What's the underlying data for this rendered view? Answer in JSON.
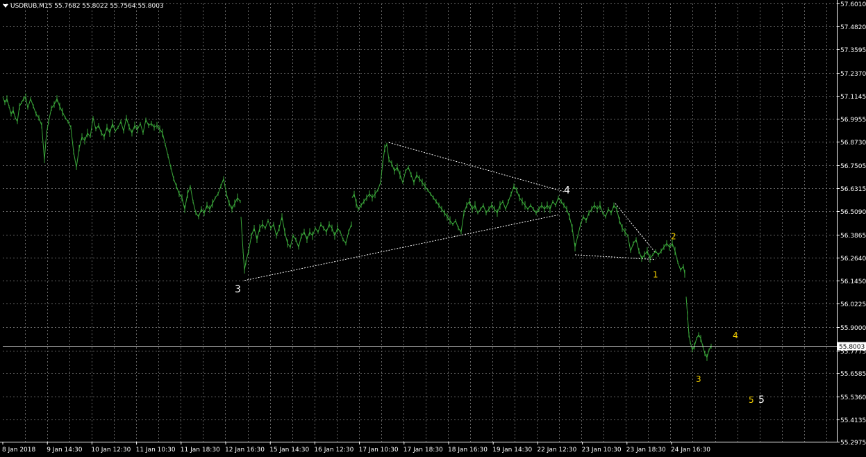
{
  "header": {
    "symbol": "USDRUB,M15",
    "open": "55.7682",
    "high": "55.8022",
    "low": "55.7564",
    "close": "55.8003"
  },
  "colors": {
    "background": "#000000",
    "grid": "#8a8a8a",
    "price_line": "#3aa83a",
    "axis_text": "#ffffff",
    "wave_white": "#ffffff",
    "wave_yellow": "#f5d000",
    "current_price_box": "#ffffff"
  },
  "chart_data": {
    "type": "line",
    "title": "USDRUB,M15",
    "grid": true,
    "ylim": [
      55.2975,
      57.601
    ],
    "y_ticks": [
      "57.6010",
      "57.4820",
      "57.3595",
      "57.2370",
      "57.1145",
      "56.9955",
      "56.8730",
      "56.7505",
      "56.6315",
      "56.5090",
      "56.3865",
      "56.2640",
      "56.1450",
      "56.0225",
      "55.9000",
      "55.7775",
      "55.6585",
      "55.5360",
      "55.4135",
      "55.2975"
    ],
    "x_tick_labels": [
      "8 Jan 2018",
      "9 Jan 14:30",
      "10 Jan 12:30",
      "11 Jan 10:30",
      "11 Jan 18:30",
      "12 Jan 16:30",
      "15 Jan 14:30",
      "16 Jan 12:30",
      "17 Jan 10:30",
      "17 Jan 18:30",
      "18 Jan 16:30",
      "19 Jan 14:30",
      "22 Jan 12:30",
      "23 Jan 10:30",
      "23 Jan 18:30",
      "24 Jan 16:30"
    ],
    "current_price": "55.8003",
    "series": [
      {
        "segments": [
          [
            [
              0,
              57.11
            ],
            [
              3,
              57.08
            ],
            [
              6,
              57.1
            ],
            [
              9,
              57.06
            ],
            [
              12,
              57.02
            ],
            [
              15,
              57.04
            ],
            [
              18,
              57.0
            ],
            [
              21,
              56.98
            ],
            [
              24,
              57.06
            ],
            [
              27,
              57.08
            ],
            [
              30,
              57.1
            ],
            [
              33,
              57.11
            ],
            [
              36,
              57.05
            ],
            [
              40,
              57.1
            ],
            [
              44,
              57.06
            ],
            [
              48,
              57.02
            ],
            [
              52,
              57.0
            ],
            [
              56,
              56.96
            ],
            [
              60,
              56.78
            ],
            [
              63,
              56.92
            ],
            [
              66,
              56.98
            ],
            [
              70,
              57.05
            ],
            [
              74,
              57.07
            ],
            [
              78,
              57.1
            ],
            [
              82,
              57.06
            ],
            [
              86,
              57.03
            ],
            [
              90,
              57.0
            ],
            [
              94,
              56.98
            ],
            [
              98,
              56.95
            ],
            [
              102,
              56.82
            ],
            [
              106,
              56.74
            ],
            [
              110,
              56.84
            ],
            [
              114,
              56.9
            ],
            [
              118,
              56.88
            ],
            [
              122,
              56.92
            ],
            [
              126,
              56.9
            ],
            [
              130,
              57.0
            ],
            [
              134,
              56.94
            ],
            [
              138,
              56.96
            ],
            [
              142,
              56.92
            ],
            [
              146,
              56.9
            ],
            [
              150,
              56.95
            ],
            [
              154,
              56.92
            ],
            [
              158,
              56.97
            ],
            [
              162,
              56.93
            ],
            [
              166,
              56.95
            ],
            [
              170,
              56.98
            ],
            [
              174,
              56.93
            ],
            [
              178,
              57.0
            ],
            [
              182,
              56.95
            ],
            [
              186,
              56.92
            ],
            [
              190,
              56.96
            ],
            [
              194,
              56.94
            ],
            [
              198,
              56.97
            ],
            [
              202,
              56.92
            ],
            [
              206,
              56.99
            ],
            [
              210,
              56.96
            ],
            [
              214,
              56.97
            ],
            [
              218,
              56.95
            ],
            [
              222,
              56.96
            ],
            [
              226,
              56.94
            ],
            [
              230,
              56.92
            ],
            [
              234,
              56.86
            ],
            [
              238,
              56.8
            ],
            [
              242,
              56.74
            ],
            [
              246,
              56.68
            ],
            [
              250,
              56.64
            ],
            [
              254,
              56.6
            ],
            [
              258,
              56.58
            ],
            [
              262,
              56.52
            ],
            [
              266,
              56.6
            ],
            [
              270,
              56.64
            ],
            [
              274,
              56.56
            ],
            [
              278,
              56.5
            ],
            [
              282,
              56.48
            ],
            [
              286,
              56.52
            ],
            [
              290,
              56.5
            ],
            [
              294,
              56.54
            ],
            [
              298,
              56.52
            ],
            [
              302,
              56.55
            ],
            [
              306,
              56.58
            ],
            [
              310,
              56.6
            ],
            [
              314,
              56.64
            ],
            [
              318,
              56.68
            ],
            [
              322,
              56.6
            ],
            [
              326,
              56.55
            ],
            [
              330,
              56.52
            ],
            [
              334,
              56.55
            ],
            [
              338,
              56.58
            ],
            [
              342,
              56.56
            ]
          ],
          [
            [
              343,
              56.48
            ],
            [
              346,
              56.3
            ],
            [
              348,
              56.2
            ],
            [
              350,
              56.24
            ],
            [
              354,
              56.3
            ],
            [
              358,
              56.38
            ],
            [
              362,
              56.42
            ],
            [
              366,
              56.36
            ],
            [
              370,
              56.42
            ],
            [
              374,
              56.44
            ],
            [
              378,
              56.42
            ],
            [
              382,
              56.46
            ],
            [
              386,
              56.42
            ],
            [
              390,
              56.44
            ],
            [
              394,
              56.38
            ],
            [
              398,
              56.42
            ],
            [
              402,
              56.48
            ],
            [
              406,
              56.4
            ],
            [
              410,
              56.34
            ],
            [
              414,
              56.32
            ],
            [
              418,
              56.38
            ],
            [
              422,
              56.36
            ],
            [
              426,
              56.32
            ],
            [
              430,
              56.38
            ],
            [
              434,
              56.4
            ],
            [
              438,
              56.36
            ],
            [
              442,
              56.4
            ],
            [
              446,
              56.38
            ],
            [
              450,
              56.42
            ],
            [
              454,
              56.4
            ],
            [
              458,
              56.44
            ],
            [
              462,
              56.42
            ],
            [
              466,
              56.4
            ],
            [
              470,
              56.44
            ],
            [
              474,
              56.42
            ],
            [
              478,
              56.38
            ],
            [
              482,
              56.42
            ],
            [
              486,
              56.4
            ],
            [
              490,
              56.36
            ],
            [
              494,
              56.34
            ],
            [
              498,
              56.4
            ],
            [
              502,
              56.44
            ]
          ],
          [
            [
              503,
              56.58
            ],
            [
              506,
              56.6
            ],
            [
              509,
              56.55
            ],
            [
              512,
              56.52
            ],
            [
              516,
              56.54
            ],
            [
              520,
              56.56
            ],
            [
              524,
              56.58
            ],
            [
              528,
              56.6
            ],
            [
              532,
              56.58
            ],
            [
              536,
              56.6
            ],
            [
              540,
              56.62
            ],
            [
              544,
              56.66
            ],
            [
              547,
              56.76
            ],
            [
              550,
              56.84
            ],
            [
              553,
              56.86
            ],
            [
              556,
              56.78
            ],
            [
              560,
              56.76
            ],
            [
              564,
              56.72
            ],
            [
              568,
              56.74
            ],
            [
              572,
              56.7
            ],
            [
              576,
              56.66
            ],
            [
              580,
              56.72
            ],
            [
              584,
              56.74
            ],
            [
              588,
              56.7
            ],
            [
              592,
              56.66
            ],
            [
              596,
              56.7
            ],
            [
              600,
              56.68
            ],
            [
              604,
              56.66
            ],
            [
              608,
              56.64
            ],
            [
              612,
              56.62
            ],
            [
              616,
              56.6
            ],
            [
              620,
              56.58
            ],
            [
              624,
              56.56
            ],
            [
              628,
              56.54
            ],
            [
              632,
              56.52
            ],
            [
              636,
              56.5
            ],
            [
              640,
              56.48
            ],
            [
              644,
              56.46
            ],
            [
              648,
              56.44
            ],
            [
              652,
              56.46
            ],
            [
              656,
              56.42
            ],
            [
              660,
              56.4
            ],
            [
              664,
              56.5
            ],
            [
              668,
              56.54
            ],
            [
              672,
              56.56
            ],
            [
              676,
              56.52
            ],
            [
              680,
              56.54
            ],
            [
              684,
              56.5
            ],
            [
              688,
              56.52
            ],
            [
              692,
              56.54
            ],
            [
              696,
              56.5
            ],
            [
              700,
              56.52
            ],
            [
              704,
              56.54
            ],
            [
              708,
              56.52
            ],
            [
              712,
              56.5
            ],
            [
              716,
              56.54
            ],
            [
              720,
              56.56
            ],
            [
              724,
              56.52
            ],
            [
              728,
              56.56
            ],
            [
              732,
              56.6
            ],
            [
              736,
              56.64
            ],
            [
              740,
              56.62
            ],
            [
              744,
              56.58
            ],
            [
              748,
              56.56
            ],
            [
              752,
              56.54
            ],
            [
              756,
              56.52
            ],
            [
              760,
              56.54
            ],
            [
              764,
              56.52
            ],
            [
              768,
              56.5
            ],
            [
              772,
              56.52
            ],
            [
              776,
              56.54
            ],
            [
              780,
              56.52
            ],
            [
              784,
              56.54
            ],
            [
              788,
              56.52
            ],
            [
              792,
              56.56
            ],
            [
              796,
              56.54
            ],
            [
              800,
              56.58
            ],
            [
              804,
              56.56
            ],
            [
              808,
              56.54
            ],
            [
              812,
              56.52
            ],
            [
              816,
              56.48
            ],
            [
              820,
              56.42
            ],
            [
              824,
              56.32
            ],
            [
              828,
              56.38
            ],
            [
              832,
              56.44
            ],
            [
              836,
              56.48
            ],
            [
              840,
              56.46
            ],
            [
              844,
              56.5
            ],
            [
              848,
              56.52
            ],
            [
              852,
              56.54
            ],
            [
              856,
              56.52
            ],
            [
              860,
              56.54
            ],
            [
              864,
              56.5
            ],
            [
              868,
              56.48
            ],
            [
              872,
              56.52
            ],
            [
              876,
              56.5
            ],
            [
              880,
              56.54
            ],
            [
              884,
              56.52
            ],
            [
              888,
              56.46
            ],
            [
              892,
              56.42
            ],
            [
              896,
              56.4
            ],
            [
              900,
              56.38
            ],
            [
              904,
              56.3
            ],
            [
              908,
              56.34
            ],
            [
              912,
              56.36
            ],
            [
              916,
              56.3
            ],
            [
              920,
              56.26
            ],
            [
              924,
              56.28
            ],
            [
              928,
              56.3
            ],
            [
              932,
              56.26
            ],
            [
              936,
              56.28
            ],
            [
              940,
              56.3
            ],
            [
              944,
              56.28
            ],
            [
              948,
              56.3
            ],
            [
              952,
              56.32
            ],
            [
              956,
              56.34
            ],
            [
              960,
              56.32
            ],
            [
              964,
              56.34
            ],
            [
              968,
              56.3
            ],
            [
              972,
              56.24
            ],
            [
              976,
              56.2
            ],
            [
              980,
              56.22
            ],
            [
              982,
              56.18
            ]
          ],
          [
            [
              984,
              56.06
            ],
            [
              986,
              55.96
            ],
            [
              988,
              55.86
            ],
            [
              990,
              55.82
            ],
            [
              993,
              55.78
            ],
            [
              996,
              55.8
            ],
            [
              999,
              55.84
            ],
            [
              1002,
              55.86
            ],
            [
              1005,
              55.84
            ],
            [
              1008,
              55.8
            ],
            [
              1011,
              55.76
            ],
            [
              1014,
              55.74
            ],
            [
              1017,
              55.78
            ],
            [
              1020,
              55.8
            ]
          ]
        ]
      }
    ],
    "annotations": {
      "wave_labels_white": [
        "3",
        "4",
        "5"
      ],
      "wave_labels_yellow": [
        "1",
        "2",
        "3",
        "4",
        "5"
      ]
    }
  }
}
